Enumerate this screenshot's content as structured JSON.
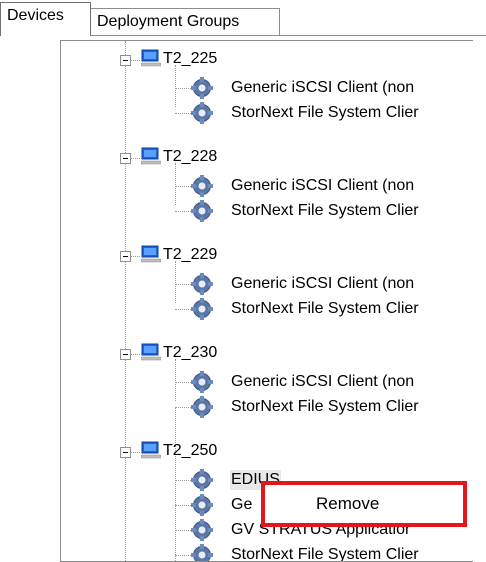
{
  "tabs": [
    {
      "label": "Devices",
      "active": true
    },
    {
      "label": "Deployment Groups",
      "active": false
    }
  ],
  "tree": {
    "devices": [
      {
        "name": "T2_225",
        "children": [
          "Generic iSCSI Client (non",
          "StorNext File System Clier"
        ]
      },
      {
        "name": "T2_228",
        "children": [
          "Generic iSCSI Client (non",
          "StorNext File System Clier"
        ]
      },
      {
        "name": "T2_229",
        "children": [
          "Generic iSCSI Client (non",
          "StorNext File System Clier"
        ]
      },
      {
        "name": "T2_230",
        "children": [
          "Generic iSCSI Client (non",
          "StorNext File System Clier"
        ]
      },
      {
        "name": "T2_250",
        "children": [
          "EDIUS",
          "Ge",
          "GV STRATUS Applicatior",
          "StorNext File System Clier"
        ]
      }
    ]
  },
  "context_menu": {
    "items": [
      "Remove"
    ],
    "highlight_color": "#e3161d"
  },
  "icons": {
    "device": "computer-icon",
    "service": "gear-icon",
    "expander": "minus-expander-icon",
    "scroll_up": "arrow-up-icon"
  }
}
